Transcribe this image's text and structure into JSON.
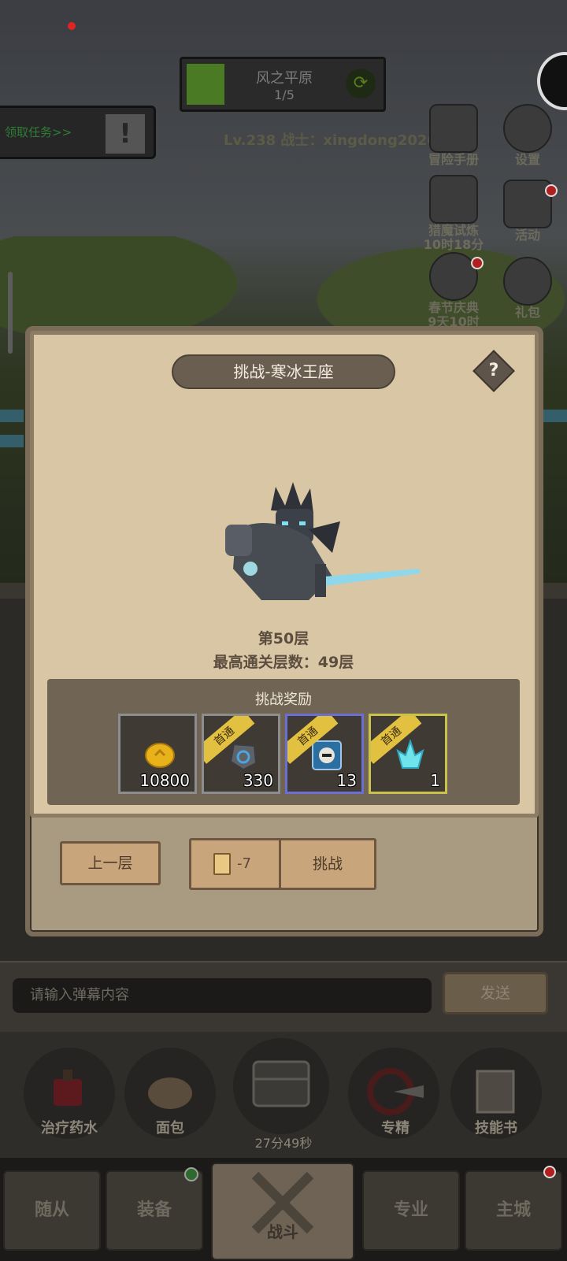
{
  "hud": {
    "stage_name": "风之平原",
    "stage_progress": "1/5",
    "quest_label": "领取任务>>",
    "player_info": "Lv.238 战士：xingdong2026",
    "side_buttons": [
      {
        "label": "冒险手册",
        "icon": "book-icon"
      },
      {
        "label": "设置",
        "icon": "gear-icon"
      },
      {
        "label": "猎魔试炼",
        "sub": "10时18分",
        "icon": "demon-icon"
      },
      {
        "label": "活动",
        "icon": "scroll-icon"
      },
      {
        "label": "春节庆典",
        "sub": "9天10时",
        "icon": "lion-icon"
      },
      {
        "label": "礼包",
        "icon": "coin-bag-icon"
      }
    ]
  },
  "dialog": {
    "title": "挑战-寒冰王座",
    "help": "?",
    "floor": "第50层",
    "best_floor": "最高通关层数：49层",
    "rewards_title": "挑战奖励",
    "rewards": [
      {
        "item": "gold-coin-icon",
        "qty": "10800",
        "first_clear": "",
        "rarity": "common"
      },
      {
        "item": "rune-stone-icon",
        "qty": "330",
        "first_clear": "首通",
        "rarity": "common"
      },
      {
        "item": "knight-card-icon",
        "qty": "13",
        "first_clear": "首通",
        "rarity": "epic"
      },
      {
        "item": "ice-crystal-icon",
        "qty": "1",
        "first_clear": "首通",
        "rarity": "legend"
      }
    ],
    "prev_button": "上一层",
    "cost": "-7",
    "challenge_button": "挑战"
  },
  "chat": {
    "placeholder": "请输入弹幕内容",
    "send": "发送"
  },
  "consumables": [
    {
      "label": "治疗药水"
    },
    {
      "label": "面包"
    },
    {
      "label": "专精"
    },
    {
      "label": "技能书"
    }
  ],
  "timer": "27分49秒",
  "nav": {
    "tabs": [
      "随从",
      "装备",
      "战斗",
      "专业",
      "主城"
    ]
  }
}
